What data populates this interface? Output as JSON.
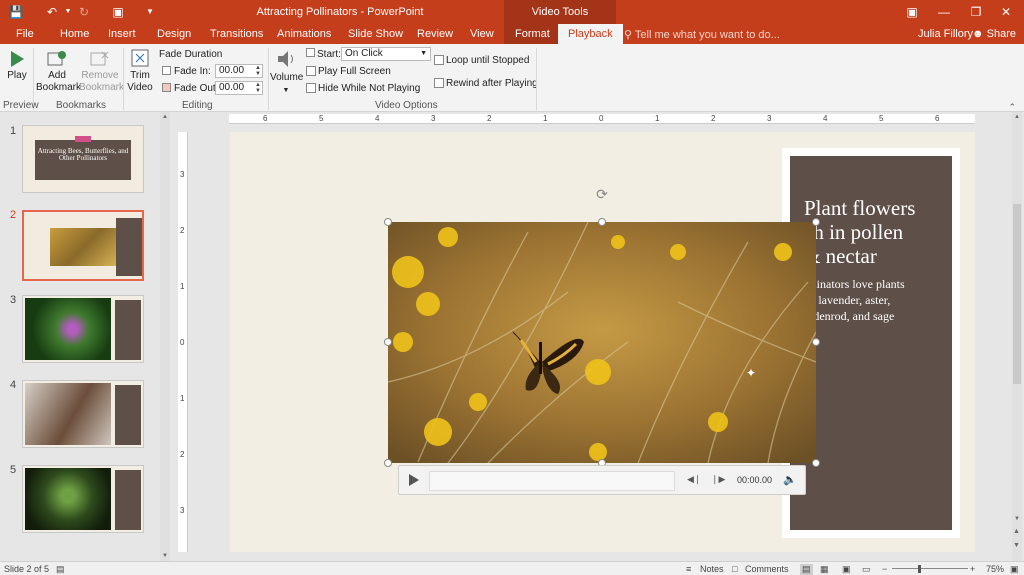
{
  "titlebar": {
    "doc_title": "Attracting Pollinators - PowerPoint",
    "context_title": "Video Tools",
    "accent": "#c43e1c",
    "context_accent": "#a33418"
  },
  "tabs": [
    "File",
    "Home",
    "Insert",
    "Design",
    "Transitions",
    "Animations",
    "Slide Show",
    "Review",
    "View",
    "Format",
    "Playback"
  ],
  "active_tab": "Playback",
  "tell_me": "Tell me what you want to do...",
  "user": "Julia Fillory",
  "share": "Share",
  "ribbon": {
    "play": "Play",
    "add_bookmark": [
      "Add",
      "Bookmark"
    ],
    "remove_bookmark": [
      "Remove",
      "Bookmark"
    ],
    "trim_video": [
      "Trim",
      "Video"
    ],
    "fade_duration": "Fade Duration",
    "fade_in_label": "Fade In:",
    "fade_in_value": "00.00",
    "fade_out_label": "Fade Out:",
    "fade_out_value": "00.00",
    "volume": "Volume",
    "start_label": "Start:",
    "start_value": "On Click",
    "play_full_screen": "Play Full Screen",
    "hide_while_not_playing": "Hide While Not Playing",
    "loop_until_stopped": "Loop until Stopped",
    "rewind_after_playing": "Rewind after Playing",
    "groups": {
      "preview": "Preview",
      "bookmarks": "Bookmarks",
      "editing": "Editing",
      "video_options": "Video Options"
    }
  },
  "thumbnails": [
    {
      "num": "1",
      "text": "Attracting Bees, Butterflies, and Other Pollinators"
    },
    {
      "num": "2",
      "text": ""
    },
    {
      "num": "3",
      "text": ""
    },
    {
      "num": "4",
      "text": ""
    },
    {
      "num": "5",
      "text": ""
    }
  ],
  "selected_slide": 2,
  "ruler": {
    "h_labels": [
      "6",
      "5",
      "4",
      "3",
      "2",
      "1",
      "0",
      "1",
      "2",
      "3",
      "4",
      "5",
      "6"
    ],
    "v_labels": [
      "3",
      "2",
      "1",
      "0",
      "1",
      "2",
      "3"
    ]
  },
  "slide": {
    "heading": "Plant flowers rich in pollen & nectar",
    "heading_visible": [
      "Plant flowers",
      "ch in pollen",
      "& nectar"
    ],
    "body_visible": [
      "ollinators love plants",
      "ke lavender, aster,",
      "oldenrod, and sage"
    ],
    "panel_color": "#5e4f48"
  },
  "video_controls": {
    "time": "00:00.00"
  },
  "statusbar": {
    "slide_info": "Slide 2 of 5",
    "notes": "Notes",
    "comments": "Comments",
    "zoom": "75%"
  }
}
